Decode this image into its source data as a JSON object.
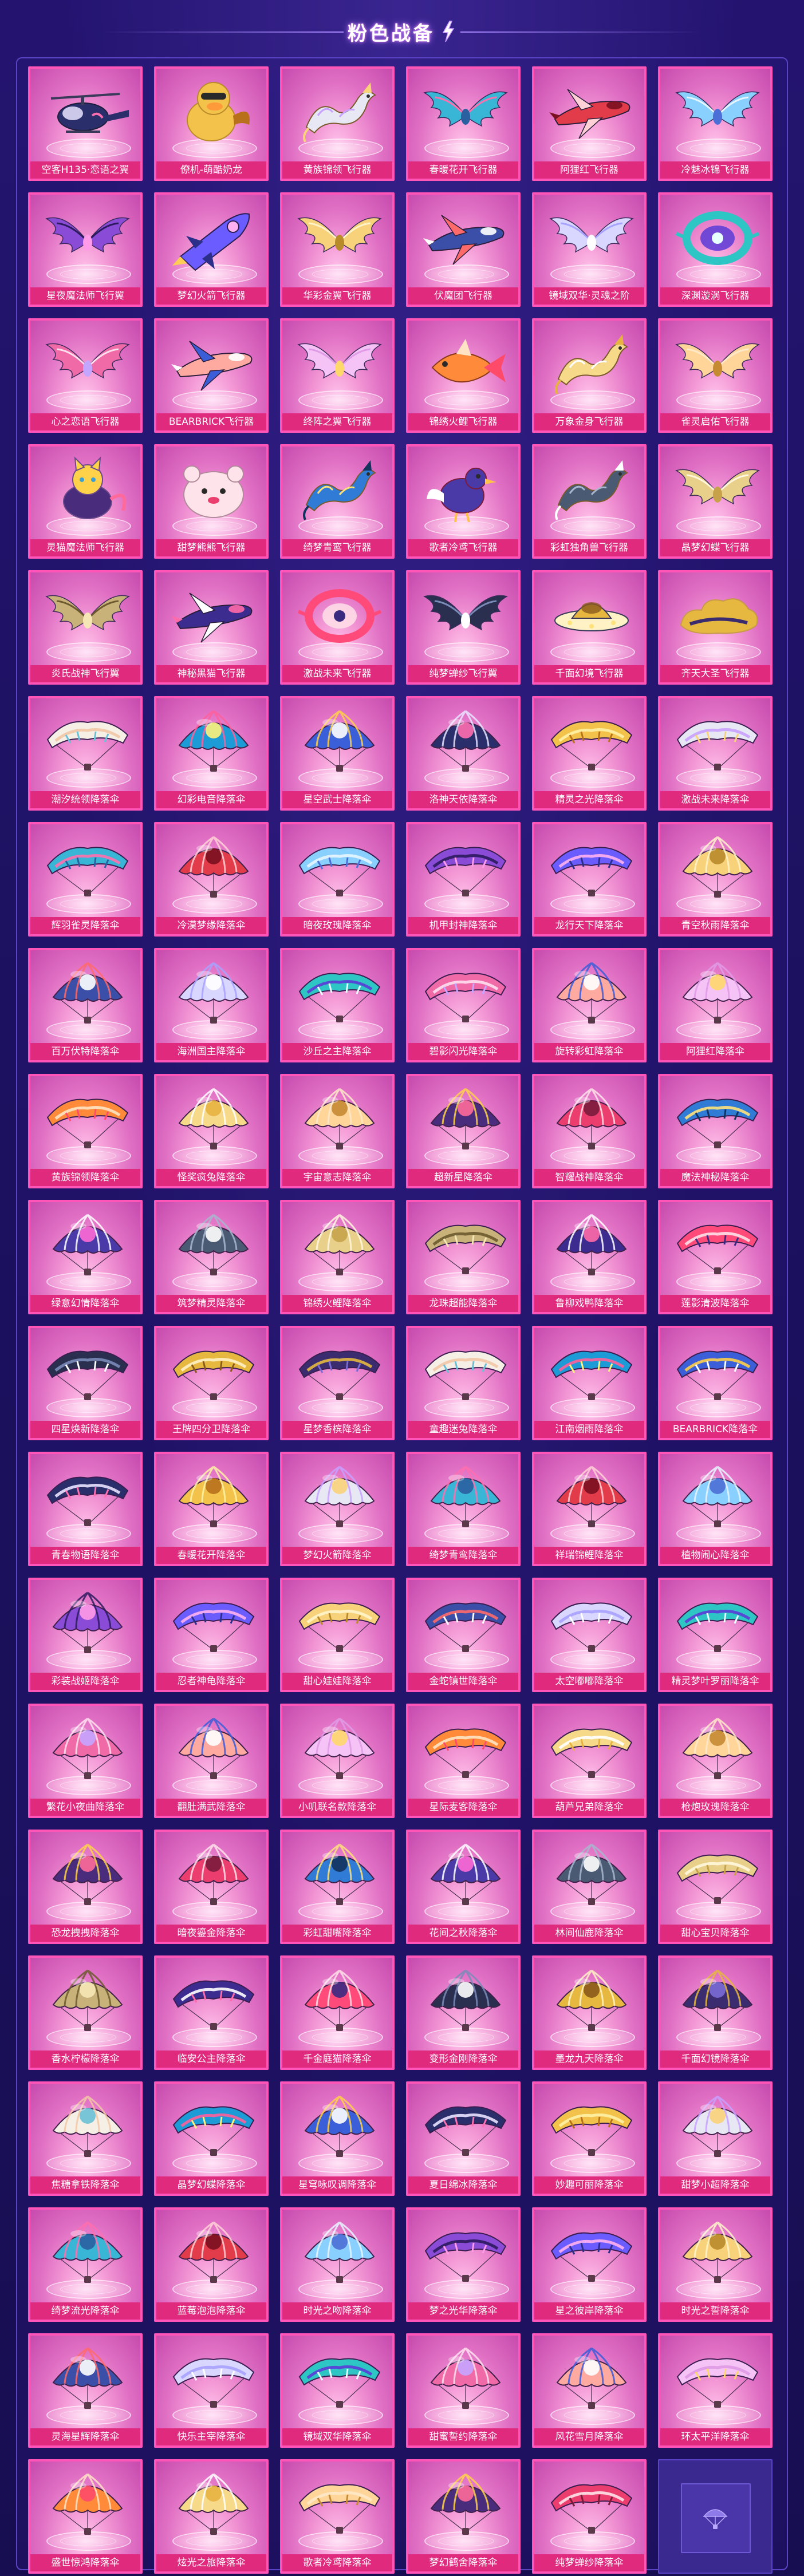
{
  "header": {
    "title": "粉色战备"
  },
  "colors": {
    "accent": "#ff55b9",
    "label_bg": "#df2a7e",
    "background": "#1c1160"
  },
  "items": [
    {
      "label": "空客H135·恋语之翼",
      "type": "heli"
    },
    {
      "label": "僚机-萌酷奶龙",
      "type": "duck"
    },
    {
      "label": "黄族锦领飞行器",
      "type": "dragon"
    },
    {
      "label": "春暖花开飞行器",
      "type": "wings"
    },
    {
      "label": "阿狸红飞行器",
      "type": "jet"
    },
    {
      "label": "冷魅冰锦飞行器",
      "type": "wings"
    },
    {
      "label": "星夜魔法师飞行翼",
      "type": "wings"
    },
    {
      "label": "梦幻火箭飞行器",
      "type": "rocket"
    },
    {
      "label": "华彩金翼飞行器",
      "type": "wings"
    },
    {
      "label": "伏魔团飞行器",
      "type": "jet"
    },
    {
      "label": "镜域双华·灵魂之阶",
      "type": "wings"
    },
    {
      "label": "深渊漩涡飞行器",
      "type": "ring"
    },
    {
      "label": "心之恋语飞行器",
      "type": "wings"
    },
    {
      "label": "BEARBRICK飞行器",
      "type": "jet"
    },
    {
      "label": "终阵之翼飞行器",
      "type": "wings"
    },
    {
      "label": "锦绣火鲤飞行器",
      "type": "fish"
    },
    {
      "label": "万象金身飞行器",
      "type": "dragon"
    },
    {
      "label": "雀灵启佑飞行器",
      "type": "wings"
    },
    {
      "label": "灵猫魔法师飞行器",
      "type": "cat"
    },
    {
      "label": "甜梦熊熊飞行器",
      "type": "bear"
    },
    {
      "label": "绮梦青鸾飞行器",
      "type": "dragon"
    },
    {
      "label": "歌者冷鸢飞行器",
      "type": "bird"
    },
    {
      "label": "彩虹独角兽飞行器",
      "type": "dragon"
    },
    {
      "label": "晶梦幻蝶飞行器",
      "type": "wings"
    },
    {
      "label": "炎氏战神飞行翼",
      "type": "wings"
    },
    {
      "label": "神秘黑猫飞行器",
      "type": "jet"
    },
    {
      "label": "激战未来飞行器",
      "type": "ring"
    },
    {
      "label": "纯梦蝉纱飞行翼",
      "type": "wings"
    },
    {
      "label": "千面幻境飞行器",
      "type": "ufo"
    },
    {
      "label": "齐天大圣飞行器",
      "type": "cloud"
    },
    {
      "label": "潮汐统领降落伞",
      "type": "glider"
    },
    {
      "label": "幻彩电音降落伞",
      "type": "round"
    },
    {
      "label": "星空武士降落伞",
      "type": "round"
    },
    {
      "label": "洛神天依降落伞",
      "type": "round"
    },
    {
      "label": "精灵之光降落伞",
      "type": "glider"
    },
    {
      "label": "激战未来降落伞",
      "type": "glider"
    },
    {
      "label": "辉羽雀灵降落伞",
      "type": "glider"
    },
    {
      "label": "冷漠梦缘降落伞",
      "type": "round"
    },
    {
      "label": "暗夜玫瑰降落伞",
      "type": "glider"
    },
    {
      "label": "机甲封神降落伞",
      "type": "glider"
    },
    {
      "label": "龙行天下降落伞",
      "type": "glider"
    },
    {
      "label": "青空秋雨降落伞",
      "type": "round"
    },
    {
      "label": "百万伏特降落伞",
      "type": "round"
    },
    {
      "label": "海洲国主降落伞",
      "type": "round"
    },
    {
      "label": "沙丘之主降落伞",
      "type": "glider"
    },
    {
      "label": "碧影闪光降落伞",
      "type": "glider"
    },
    {
      "label": "旋转彩虹降落伞",
      "type": "round"
    },
    {
      "label": "阿狸红降落伞",
      "type": "round"
    },
    {
      "label": "黄族锦领降落伞",
      "type": "glider"
    },
    {
      "label": "怪奖疯兔降落伞",
      "type": "round"
    },
    {
      "label": "宇宙意志降落伞",
      "type": "round"
    },
    {
      "label": "超新星降落伞",
      "type": "round"
    },
    {
      "label": "智耀战神降落伞",
      "type": "round"
    },
    {
      "label": "魔法神秘降落伞",
      "type": "glider"
    },
    {
      "label": "绿意幻情降落伞",
      "type": "round"
    },
    {
      "label": "筑梦精灵降落伞",
      "type": "round"
    },
    {
      "label": "锦绣火鲤降落伞",
      "type": "round"
    },
    {
      "label": "龙珠超能降落伞",
      "type": "glider"
    },
    {
      "label": "鲁柳戏鸭降落伞",
      "type": "round"
    },
    {
      "label": "莲影清波降落伞",
      "type": "glider"
    },
    {
      "label": "四星焕新降落伞",
      "type": "glider"
    },
    {
      "label": "王牌四分卫降落伞",
      "type": "glider"
    },
    {
      "label": "星梦香槟降落伞",
      "type": "glider"
    },
    {
      "label": "童趣迷兔降落伞",
      "type": "glider"
    },
    {
      "label": "江南烟雨降落伞",
      "type": "glider"
    },
    {
      "label": "BEARBRICK降落伞",
      "type": "glider"
    },
    {
      "label": "青春物语降落伞",
      "type": "glider"
    },
    {
      "label": "春暖花开降落伞",
      "type": "round"
    },
    {
      "label": "梦幻火箭降落伞",
      "type": "round"
    },
    {
      "label": "绮梦青鸾降落伞",
      "type": "round"
    },
    {
      "label": "祥瑞锦鲤降落伞",
      "type": "round"
    },
    {
      "label": "植物闹心降落伞",
      "type": "round"
    },
    {
      "label": "彩装战姬降落伞",
      "type": "round"
    },
    {
      "label": "忍者神龟降落伞",
      "type": "glider"
    },
    {
      "label": "甜心娃娃降落伞",
      "type": "glider"
    },
    {
      "label": "金蛇镇世降落伞",
      "type": "glider"
    },
    {
      "label": "太空嘟嘟降落伞",
      "type": "glider"
    },
    {
      "label": "精灵梦叶罗丽降落伞",
      "type": "glider"
    },
    {
      "label": "繁花小夜曲降落伞",
      "type": "round"
    },
    {
      "label": "翻肚满武降落伞",
      "type": "round"
    },
    {
      "label": "小叽联名款降落伞",
      "type": "round"
    },
    {
      "label": "星际麦客降落伞",
      "type": "glider"
    },
    {
      "label": "葫芦兄弟降落伞",
      "type": "glider"
    },
    {
      "label": "枪炮玫瑰降落伞",
      "type": "round"
    },
    {
      "label": "恐龙拽拽降落伞",
      "type": "round"
    },
    {
      "label": "暗夜鎏金降落伞",
      "type": "round"
    },
    {
      "label": "彩虹甜嘴降落伞",
      "type": "round"
    },
    {
      "label": "花间之秋降落伞",
      "type": "round"
    },
    {
      "label": "林间仙鹿降落伞",
      "type": "round"
    },
    {
      "label": "甜心宝贝降落伞",
      "type": "glider"
    },
    {
      "label": "香水柠檬降落伞",
      "type": "round"
    },
    {
      "label": "临安公主降落伞",
      "type": "glider"
    },
    {
      "label": "千金庭猫降落伞",
      "type": "round"
    },
    {
      "label": "变形金刚降落伞",
      "type": "round"
    },
    {
      "label": "墨龙九天降落伞",
      "type": "round"
    },
    {
      "label": "千面幻镜降落伞",
      "type": "round"
    },
    {
      "label": "焦糖拿铁降落伞",
      "type": "round"
    },
    {
      "label": "晶梦幻蝶降落伞",
      "type": "glider"
    },
    {
      "label": "星穹咏叹调降落伞",
      "type": "round"
    },
    {
      "label": "夏日绵冰降落伞",
      "type": "glider"
    },
    {
      "label": "妙趣可丽降落伞",
      "type": "glider"
    },
    {
      "label": "甜梦小超降落伞",
      "type": "round"
    },
    {
      "label": "绮梦流光降落伞",
      "type": "round"
    },
    {
      "label": "蓝莓泡泡降落伞",
      "type": "round"
    },
    {
      "label": "时光之吻降落伞",
      "type": "round"
    },
    {
      "label": "梦之光华降落伞",
      "type": "glider"
    },
    {
      "label": "星之彼岸降落伞",
      "type": "glider"
    },
    {
      "label": "时光之誓降落伞",
      "type": "round"
    },
    {
      "label": "灵海星辉降落伞",
      "type": "round"
    },
    {
      "label": "快乐主宰降落伞",
      "type": "glider"
    },
    {
      "label": "镜域双华降落伞",
      "type": "glider"
    },
    {
      "label": "甜蜜誓约降落伞",
      "type": "round"
    },
    {
      "label": "风花雪月降落伞",
      "type": "round"
    },
    {
      "label": "环太平洋降落伞",
      "type": "glider"
    },
    {
      "label": "盛世惊鸿降落伞",
      "type": "round"
    },
    {
      "label": "炫光之旅降落伞",
      "type": "round"
    },
    {
      "label": "歌者冷鸢降落伞",
      "type": "glider"
    },
    {
      "label": "梦幻鹤舍降落伞",
      "type": "round"
    },
    {
      "label": "纯梦蝉纱降落伞",
      "type": "glider"
    }
  ],
  "empty_slot": {
    "icon": "parachute-icon"
  }
}
